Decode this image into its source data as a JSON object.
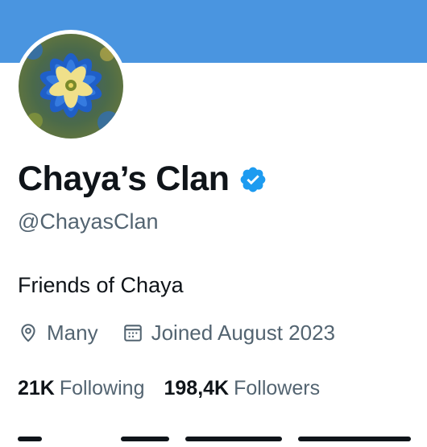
{
  "profile": {
    "display_name": "Chaya’s Clan",
    "handle": "@ChayasClan",
    "bio": "Friends of Chaya",
    "location": "Many",
    "joined": "Joined August 2023",
    "following_count": "21K",
    "following_label": "Following",
    "followers_count": "198,4K",
    "followers_label": "Followers",
    "verified": true
  },
  "colors": {
    "banner": "#4a95e0",
    "verified_badge": "#1d9bf0",
    "primary_text": "#0f1419",
    "secondary_text": "#536471"
  },
  "icons": {
    "avatar": "blue-flower-avatar",
    "verified": "verified-badge-icon",
    "location": "location-pin-icon",
    "joined": "calendar-icon"
  }
}
